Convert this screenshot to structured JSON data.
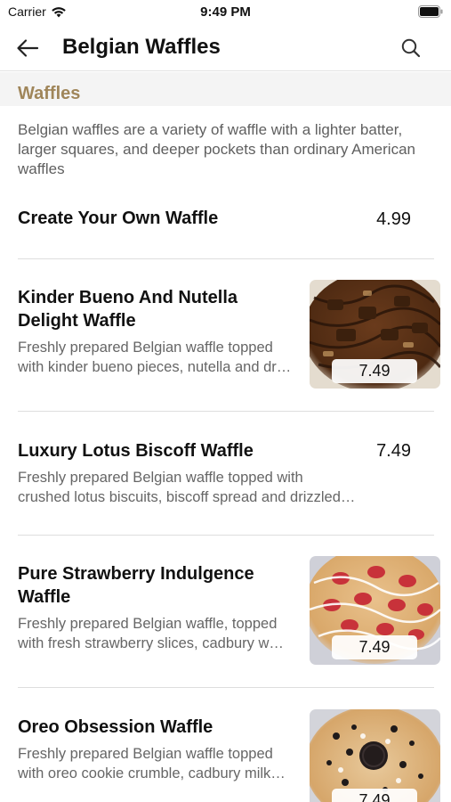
{
  "status_bar": {
    "carrier": "Carrier",
    "time": "9:49 PM"
  },
  "nav": {
    "title": "Belgian Waffles",
    "back_icon": "arrow-left-icon",
    "search_icon": "search-icon"
  },
  "section": {
    "title": "Waffles",
    "description": "Belgian waffles are a variety of waffle with a lighter batter, larger squares, and deeper pockets than ordinary American waffles"
  },
  "items": [
    {
      "title": "Create Your Own Waffle",
      "price": "4.99"
    },
    {
      "title": "Kinder Bueno And Nutella Delight Waffle",
      "desc": "Freshly prepared Belgian waffle topped with kinder bueno pieces, nutella and dr…",
      "price": "7.49"
    },
    {
      "title": "Luxury Lotus Biscoff Waffle",
      "desc": "Freshly prepared Belgian waffle topped with crushed lotus biscuits, biscoff spread and drizzled…",
      "price": "7.49"
    },
    {
      "title": "Pure Strawberry Indulgence Waffle",
      "desc": "Freshly prepared Belgian waffle, topped with fresh strawberry slices, cadbury w…",
      "price": "7.49"
    },
    {
      "title": "Oreo Obsession Waffle",
      "desc": "Freshly prepared Belgian waffle topped with oreo cookie crumble, cadbury milk…",
      "price": "7.49"
    }
  ],
  "colors": {
    "section_title": "#a0865a",
    "section_bg": "#f4f4f4",
    "text_secondary": "#666666"
  }
}
